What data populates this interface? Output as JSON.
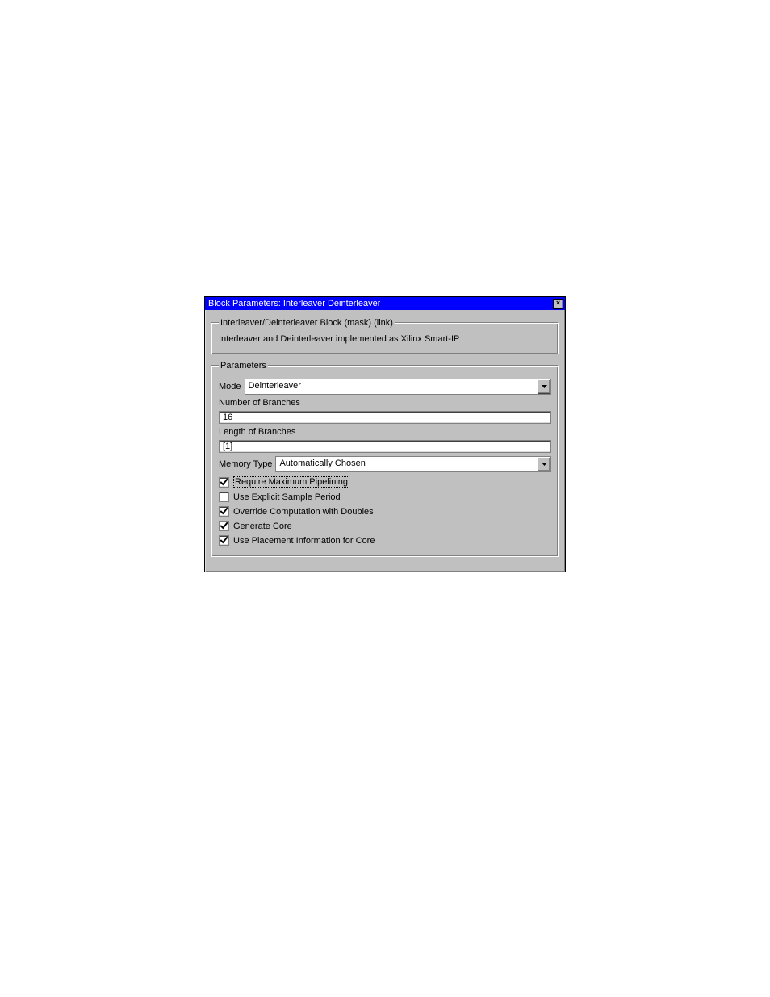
{
  "dialog": {
    "title": "Block Parameters: Interleaver Deinterleaver",
    "description": {
      "legend": "Interleaver/Deinterleaver Block (mask) (link)",
      "text": "Interleaver and Deinterleaver implemented as Xilinx Smart-IP"
    },
    "params": {
      "legend": "Parameters",
      "mode": {
        "label": "Mode",
        "value": "Deinterleaver"
      },
      "branches": {
        "label": "Number of Branches",
        "value": "16"
      },
      "length": {
        "label": "Length of Branches",
        "value": "[1]"
      },
      "memtype": {
        "label": "Memory Type",
        "value": "Automatically Chosen"
      },
      "checks": {
        "pipeline": {
          "label": "Require Maximum Pipelining",
          "checked": true
        },
        "explicit": {
          "label": "Use Explicit Sample Period",
          "checked": false
        },
        "override": {
          "label": "Override Computation with Doubles",
          "checked": true
        },
        "gencore": {
          "label": "Generate Core",
          "checked": true
        },
        "placement": {
          "label": "Use Placement Information for Core",
          "checked": true
        }
      }
    }
  }
}
